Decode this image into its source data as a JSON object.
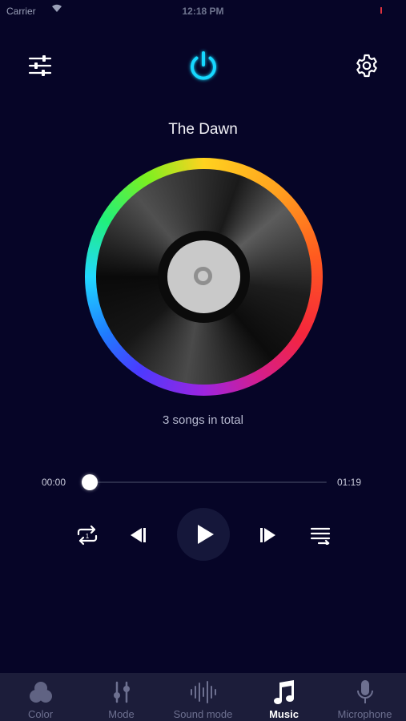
{
  "status_bar": {
    "carrier": "Carrier",
    "time": "12:18 PM"
  },
  "header": {
    "left_icon": "sliders-icon",
    "center_icon": "power-icon",
    "right_icon": "gear-icon",
    "accent_color": "#19d8ff"
  },
  "player": {
    "song_title": "The Dawn",
    "songs_total": "3 songs in total",
    "time_elapsed": "00:00",
    "time_total": "01:19",
    "progress": 0.0,
    "controls": {
      "repeat_icon": "repeat-one-icon",
      "previous_icon": "previous-icon",
      "play_icon": "play-icon",
      "next_icon": "next-icon",
      "playlist_icon": "playlist-icon"
    }
  },
  "tabs": [
    {
      "label": "Color",
      "icon": "color-circles-icon",
      "active": false
    },
    {
      "label": "Mode",
      "icon": "mode-sliders-icon",
      "active": false
    },
    {
      "label": "Sound mode",
      "icon": "sound-wave-icon",
      "active": false
    },
    {
      "label": "Music",
      "icon": "music-note-icon",
      "active": true
    },
    {
      "label": "Microphone",
      "icon": "microphone-icon",
      "active": false
    }
  ],
  "colors": {
    "background": "#060527",
    "tabbar": "#1c1d3a",
    "active_tab": "#ffffff",
    "inactive_tab": "#6d7090"
  }
}
